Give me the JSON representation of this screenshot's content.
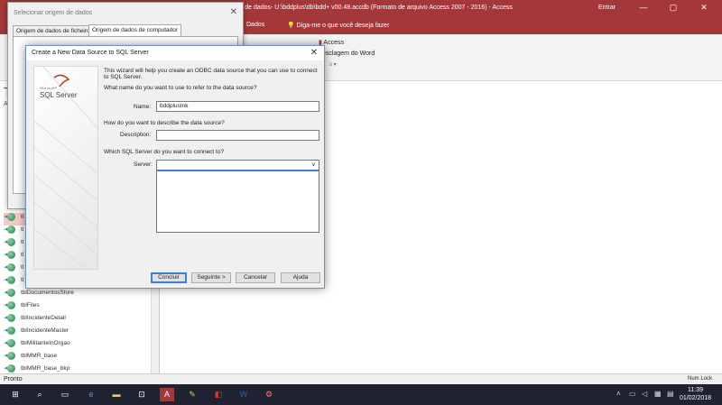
{
  "window": {
    "title": "nco de dados- U:\\bddplus\\db\\bdd+ v00.48.accdb (Formato de arquivo Access 2007 - 2016) - Access",
    "account": "Entrar",
    "controls": [
      "—",
      "▢",
      "✕"
    ]
  },
  "ribbon": {
    "tab_label": "Dados",
    "tell_me": "Diga-me o que você deseja fazer",
    "item1": "Access",
    "item2": "esclagem do Word",
    "item3": "s ▾"
  },
  "nav": {
    "header": "T",
    "search_hint": "A",
    "items": [
      "tl",
      "tl",
      "tl",
      "tl",
      "tl",
      "tl",
      "tblDocumentosStore",
      "tblFiles",
      "tblIncidenteDetail",
      "tblIncidenteMaster",
      "tblMilitanteInOrgao",
      "tblMMR_base",
      "tblMMR_base_bkp"
    ]
  },
  "statusbar": {
    "left": "Pronto",
    "right": "Num Lock"
  },
  "taskbar": {
    "time": "11:39",
    "date": "01/02/2018"
  },
  "select_window": {
    "title": "Selecionar origem de dados",
    "tab1": "Origem de dados de ficheiro",
    "tab2": "Origem de dados de computador"
  },
  "dialog": {
    "title": "Create a New Data Source to SQL Server",
    "sidebar_brand": "SQL Server",
    "intro": "This wizard will help you create an ODBC data source that you can use to connect to SQL Server.",
    "q_name": "What name do you want to use to refer to the data source?",
    "name_label": "Name:",
    "name_value": "bddplusInk",
    "q_desc": "How do you want to describe the data source?",
    "desc_label": "Description:",
    "desc_value": "",
    "q_server": "Which SQL Server do you want to connect to?",
    "server_label": "Server:",
    "server_value": "",
    "btn_finish": "Concluir",
    "btn_next": "Seguinte >",
    "btn_cancel": "Cancelar",
    "btn_help": "Ajuda"
  },
  "colors": {
    "access_red": "#a4373a",
    "taskbar": "#1f2331",
    "focus_blue": "#3c7fd6"
  }
}
